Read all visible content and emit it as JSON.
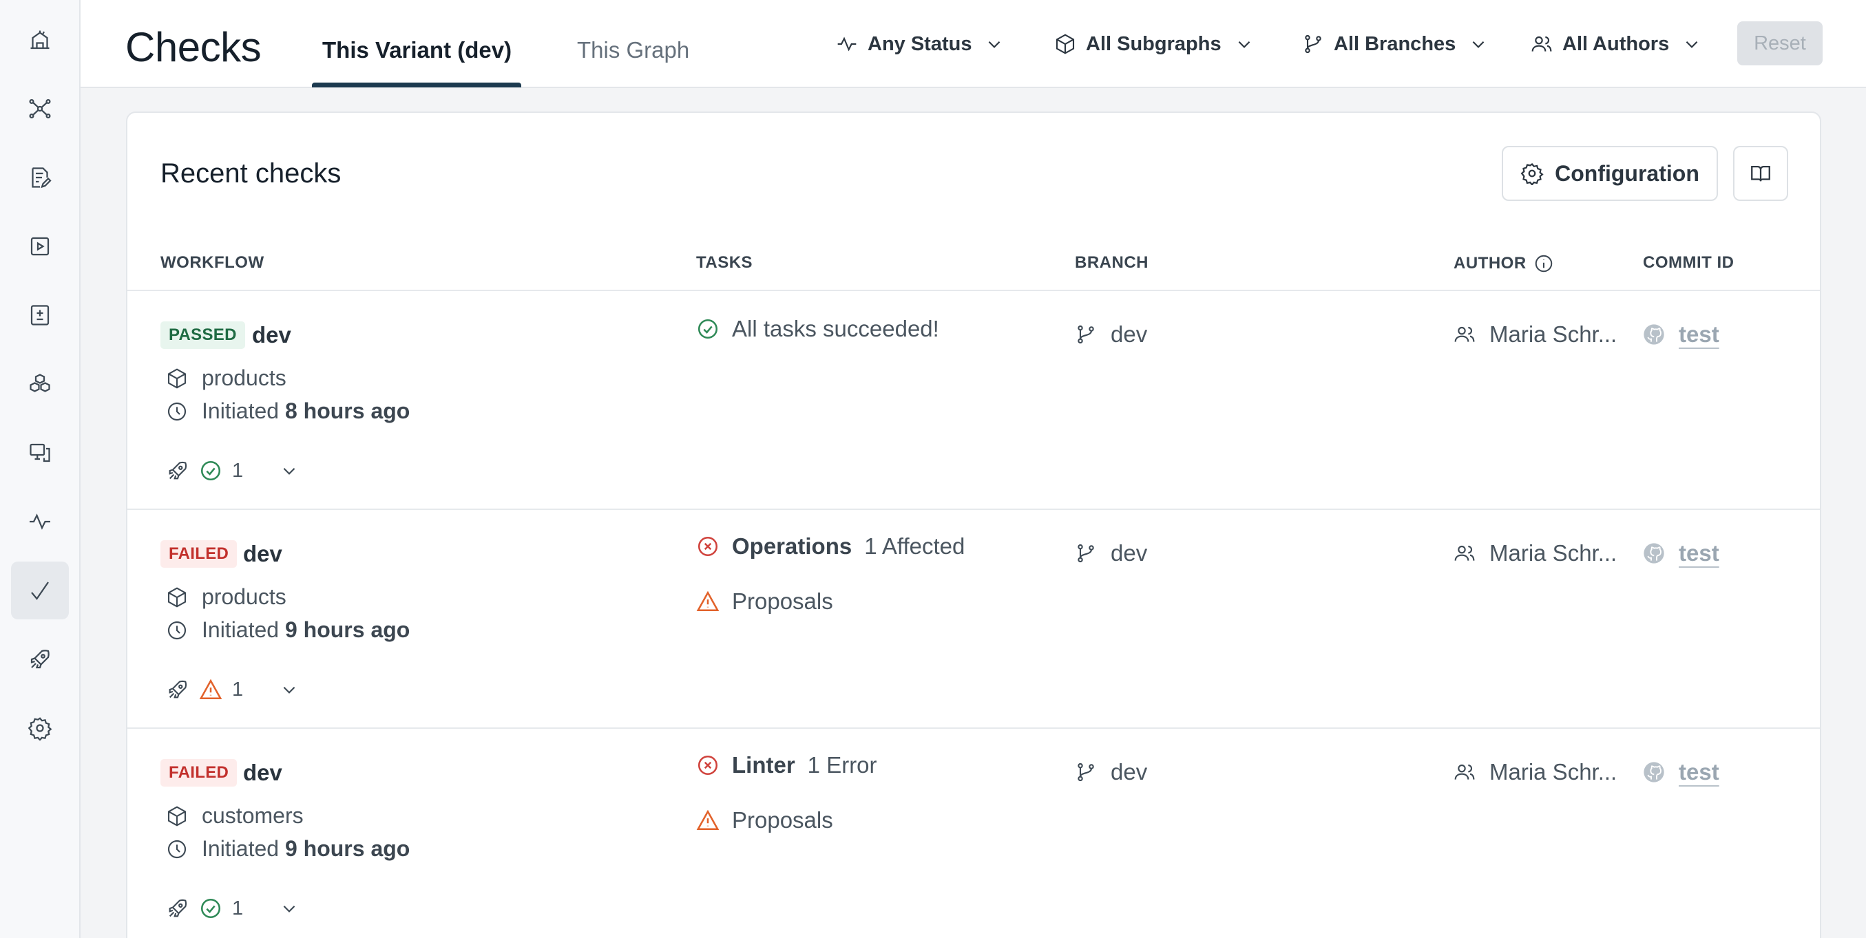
{
  "header": {
    "title": "Checks",
    "tabs": [
      {
        "label": "This Variant (dev)",
        "active": true
      },
      {
        "label": "This Graph",
        "active": false
      }
    ],
    "filters": [
      {
        "label": "Any Status",
        "icon": "pulse-icon"
      },
      {
        "label": "All Subgraphs",
        "icon": "box-icon"
      },
      {
        "label": "All Branches",
        "icon": "branch-icon"
      },
      {
        "label": "All Authors",
        "icon": "users-icon"
      }
    ],
    "reset_label": "Reset"
  },
  "sidebar": {
    "items": [
      {
        "icon": "home-icon",
        "active": false
      },
      {
        "icon": "graph-icon",
        "active": false
      },
      {
        "icon": "schema-edit-icon",
        "active": false
      },
      {
        "icon": "explorer-play-icon",
        "active": false
      },
      {
        "icon": "changelog-icon",
        "active": false
      },
      {
        "icon": "subgraphs-icon",
        "active": false
      },
      {
        "icon": "clients-icon",
        "active": false
      },
      {
        "icon": "insights-icon",
        "active": false
      },
      {
        "icon": "checks-icon",
        "active": true
      },
      {
        "icon": "launches-icon",
        "active": false
      },
      {
        "icon": "settings-icon",
        "active": false
      }
    ]
  },
  "main": {
    "card_title": "Recent checks",
    "configuration_label": "Configuration",
    "columns": {
      "workflow": "WORKFLOW",
      "tasks": "TASKS",
      "branch": "BRANCH",
      "author": "AUTHOR",
      "commit": "COMMIT ID"
    },
    "rows": [
      {
        "status": "PASSED",
        "variant": "dev",
        "subgraph": "products",
        "initiated_prefix": "Initiated",
        "initiated_time": "8 hours ago",
        "summary_count": "1",
        "summary_status": "success",
        "tasks": [
          {
            "type": "success",
            "label": "All tasks succeeded!",
            "detail": ""
          }
        ],
        "branch": "dev",
        "author": "Maria Schr...",
        "commit": "test"
      },
      {
        "status": "FAILED",
        "variant": "dev",
        "subgraph": "products",
        "initiated_prefix": "Initiated",
        "initiated_time": "9 hours ago",
        "summary_count": "1",
        "summary_status": "warning",
        "tasks": [
          {
            "type": "error",
            "label": "Operations",
            "detail": "1 Affected"
          },
          {
            "type": "warning",
            "label": "Proposals",
            "detail": ""
          }
        ],
        "branch": "dev",
        "author": "Maria Schr...",
        "commit": "test"
      },
      {
        "status": "FAILED",
        "variant": "dev",
        "subgraph": "customers",
        "initiated_prefix": "Initiated",
        "initiated_time": "9 hours ago",
        "summary_count": "1",
        "summary_status": "success",
        "tasks": [
          {
            "type": "error",
            "label": "Linter",
            "detail": "1 Error"
          },
          {
            "type": "warning",
            "label": "Proposals",
            "detail": ""
          }
        ],
        "branch": "dev",
        "author": "Maria Schr...",
        "commit": "test"
      }
    ]
  },
  "colors": {
    "passed_text": "#1f6b43",
    "passed_bg": "#e8f5ee",
    "failed_text": "#c2302c",
    "failed_bg": "#fdeceb",
    "success_icon": "#2f8a57",
    "error_icon": "#d0433d",
    "warning_icon": "#e2622b",
    "tab_underline": "#1c3a4f"
  }
}
